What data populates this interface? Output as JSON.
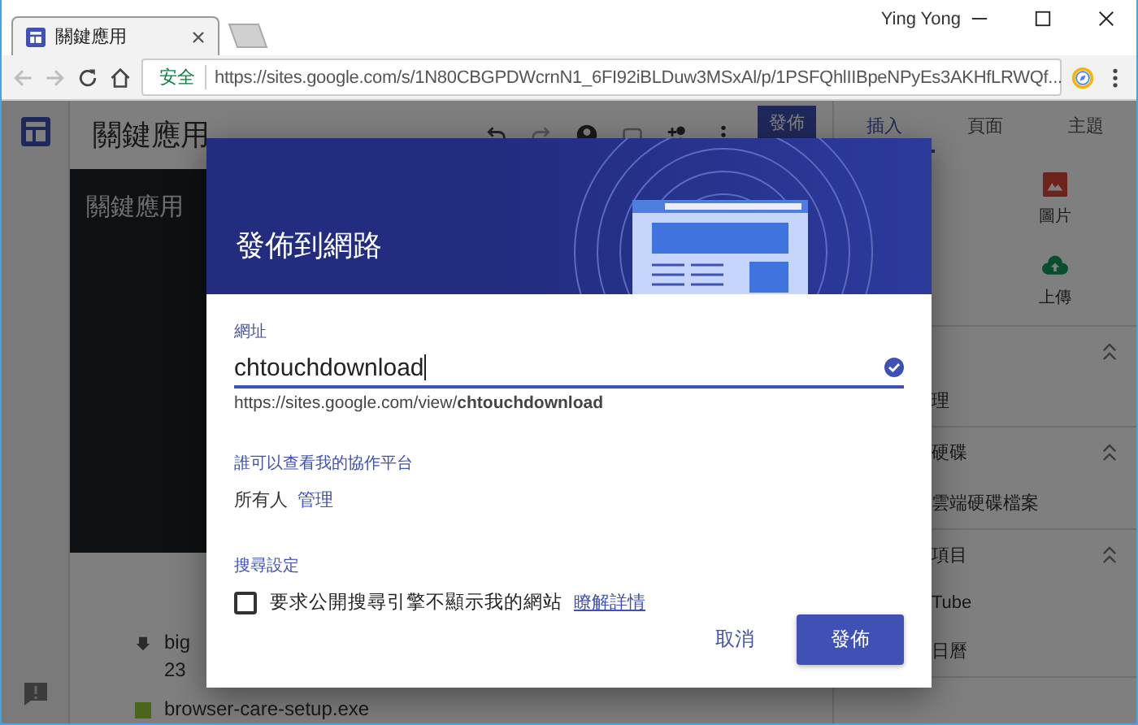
{
  "browser": {
    "tab": {
      "title": "關鍵應用",
      "selected": true
    },
    "profile": "Ying Yong",
    "security_label": "安全",
    "url": "https://sites.google.com/s/1N80CBGPDWcrnN1_6FI92iBLDuw3MSxAl/p/1PSFQhlIIBpeNPyEs3AKHfLRWQf..."
  },
  "app": {
    "title": "關鍵應用",
    "publish_button": "發佈",
    "hero_title": "關鍵應用",
    "side_tabs": [
      {
        "label": "插入",
        "selected": true
      },
      {
        "label": "頁面",
        "selected": false
      },
      {
        "label": "主題",
        "selected": false
      }
    ],
    "insert_tiles": [
      {
        "label": "圖片",
        "kind": "image"
      },
      {
        "label": "上傳",
        "kind": "upload"
      }
    ],
    "groups": [
      {
        "items": [
          "理"
        ]
      },
      {
        "header": "硬碟",
        "items": [
          "雲端硬碟檔案"
        ]
      },
      {
        "header": "項目",
        "items": [
          "Tube",
          "日曆"
        ]
      }
    ],
    "downloads": [
      {
        "name": "big",
        "detail": "23"
      },
      {
        "name": "browser-care-setup.exe"
      }
    ]
  },
  "dialog": {
    "title": "發佈到網路",
    "url_label": "網址",
    "url_value": "chtouchdownload",
    "url_valid": true,
    "url_preview": "https://sites.google.com/view/**chtouchdownload**",
    "visibility_label": "誰可以查看我的協作平台",
    "visibility_value": "所有人",
    "manage_link": "管理",
    "search_label": "搜尋設定",
    "search_option": {
      "label": "要求公開搜尋引擎不顯示我的網站",
      "checked": false
    },
    "learn_more": "瞭解詳情",
    "buttons": [
      {
        "label": "取消",
        "kind": "text"
      },
      {
        "label": "發佈",
        "kind": "primary"
      }
    ]
  }
}
